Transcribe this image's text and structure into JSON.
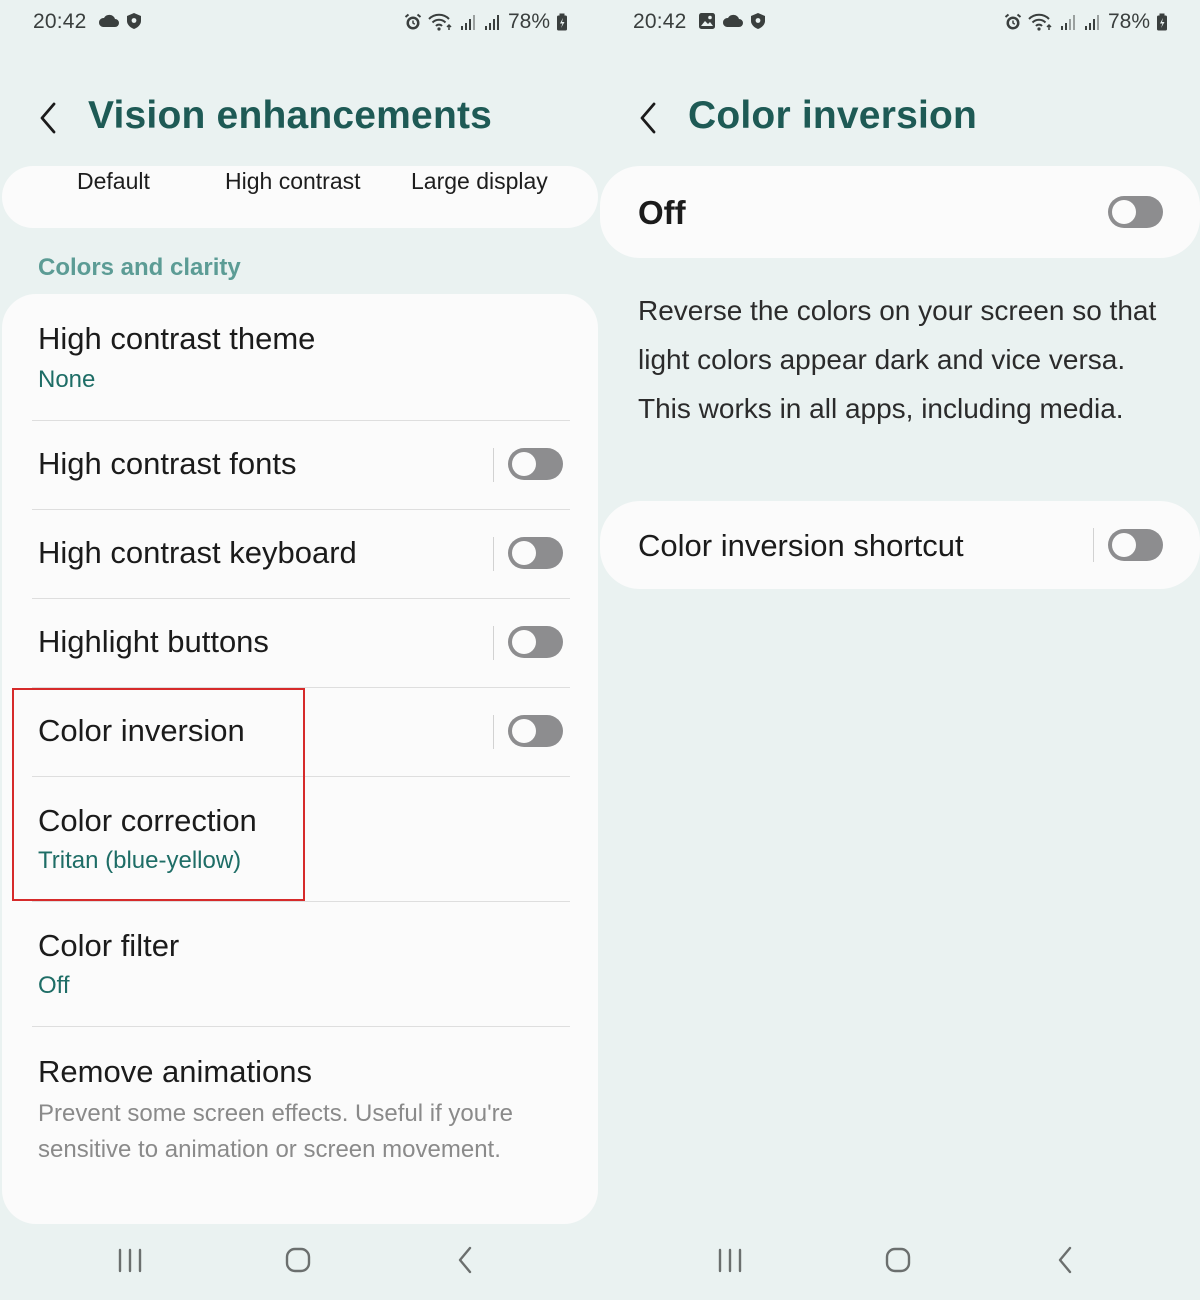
{
  "colors": {
    "background": "#eaf2f1",
    "card": "#fbfbfb",
    "title": "#1e5a55",
    "section_label": "#5c9c95",
    "subtitle": "#1e6d66",
    "toggle_off": "#8d8d8f",
    "highlight": "#d62a2a"
  },
  "left": {
    "status": {
      "time": "20:42",
      "battery": "78%",
      "icons": [
        "cloud-icon",
        "shield-icon",
        "alarm-icon",
        "wifi-icon",
        "signal-icon",
        "signal-icon",
        "battery-icon"
      ]
    },
    "header": {
      "title": "Vision enhancements",
      "back_icon": "chevron-left-icon"
    },
    "tabs": [
      "Default",
      "High contrast",
      "Large display"
    ],
    "section_label": "Colors and clarity",
    "items": [
      {
        "title": "High contrast theme",
        "subtitle": "None"
      },
      {
        "title": "High contrast fonts",
        "toggle": false
      },
      {
        "title": "High contrast keyboard",
        "toggle": false
      },
      {
        "title": "Highlight buttons",
        "toggle": false
      },
      {
        "title": "Color inversion",
        "toggle": false
      },
      {
        "title": "Color correction",
        "subtitle": "Tritan (blue-yellow)"
      },
      {
        "title": "Color filter",
        "subtitle": "Off"
      },
      {
        "title": "Remove animations",
        "description": "Prevent some screen effects. Useful if you're sensitive to animation or screen movement."
      }
    ],
    "nav": [
      "recents-icon",
      "home-icon",
      "back-icon"
    ]
  },
  "right": {
    "status": {
      "time": "20:42",
      "battery": "78%",
      "icons": [
        "image-icon",
        "cloud-icon",
        "shield-icon",
        "alarm-icon",
        "wifi-icon",
        "signal-icon",
        "signal-icon",
        "battery-icon"
      ]
    },
    "header": {
      "title": "Color inversion",
      "back_icon": "chevron-left-icon"
    },
    "master_toggle": {
      "label": "Off",
      "toggle": false
    },
    "description": "Reverse the colors on your screen so that light colors appear dark and vice versa. This works in all apps, including media.",
    "shortcut": {
      "label": "Color inversion shortcut",
      "toggle": false
    },
    "nav": [
      "recents-icon",
      "home-icon",
      "back-icon"
    ]
  }
}
